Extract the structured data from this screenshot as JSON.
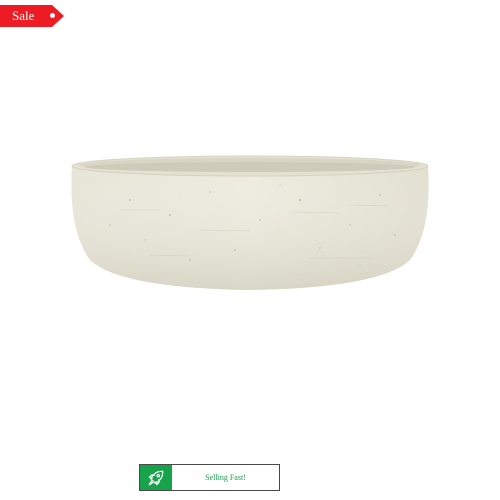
{
  "sale_tag": {
    "label": "Sale",
    "color": "#ed1c24"
  },
  "product": {
    "image_icon": "ceramic-bowl-image"
  },
  "badge": {
    "label": "Selling Fast!",
    "icon": "rocket-icon",
    "accent": "#16a34a"
  }
}
